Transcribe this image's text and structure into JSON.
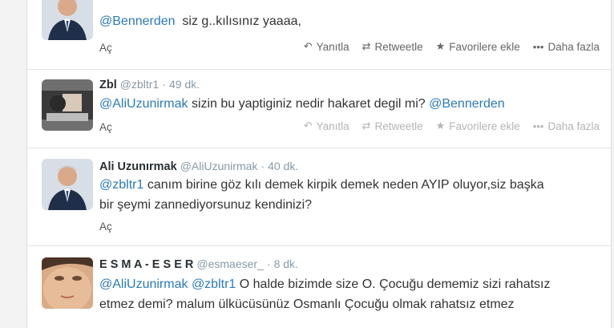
{
  "actions": {
    "reply": "Yanıtla",
    "retweet": "Retweetle",
    "favorite": "Favorilere ekle",
    "more": "Daha fazla"
  },
  "expand_label": "Aç",
  "tweets": [
    {
      "fullname": "",
      "username": "",
      "time": "",
      "mention1": "@Bennerden",
      "body": "siz g..kılısınız yaaaa,"
    },
    {
      "fullname": "Zbl",
      "username": "@zbltr1",
      "time": "49 dk.",
      "mention1": "@AliUzunirmak",
      "body": "sizin bu yaptiginiz nedir hakaret degil mi?",
      "mention2": "@Bennerden"
    },
    {
      "fullname": "Ali Uzunırmak",
      "username": "@AliUzunirmak",
      "time": "40 dk.",
      "mention1": "@zbltr1",
      "body_line1": "canım birine göz kılı demek kirpik demek neden AYIP oluyor,siz başka",
      "body_line2": "bir şeymi zannediyorsunuz kendinizi?"
    },
    {
      "fullname": "E S M A - E S E R",
      "username": "@esmaeser_",
      "time": "8 dk.",
      "mention1": "@AliUzunirmak",
      "mention2": "@zbltr1",
      "body_line1": "O halde bizimde size O. Çocuğu dememiz sizi rahatsız",
      "body_line2": "etmez demi? malum ülkücüsünüz Osmanlı Çocuğu olmak rahatsız etmez"
    }
  ],
  "colors": {
    "link": "#2b7bb9",
    "meta": "#8899a6",
    "name": "#292f33"
  }
}
